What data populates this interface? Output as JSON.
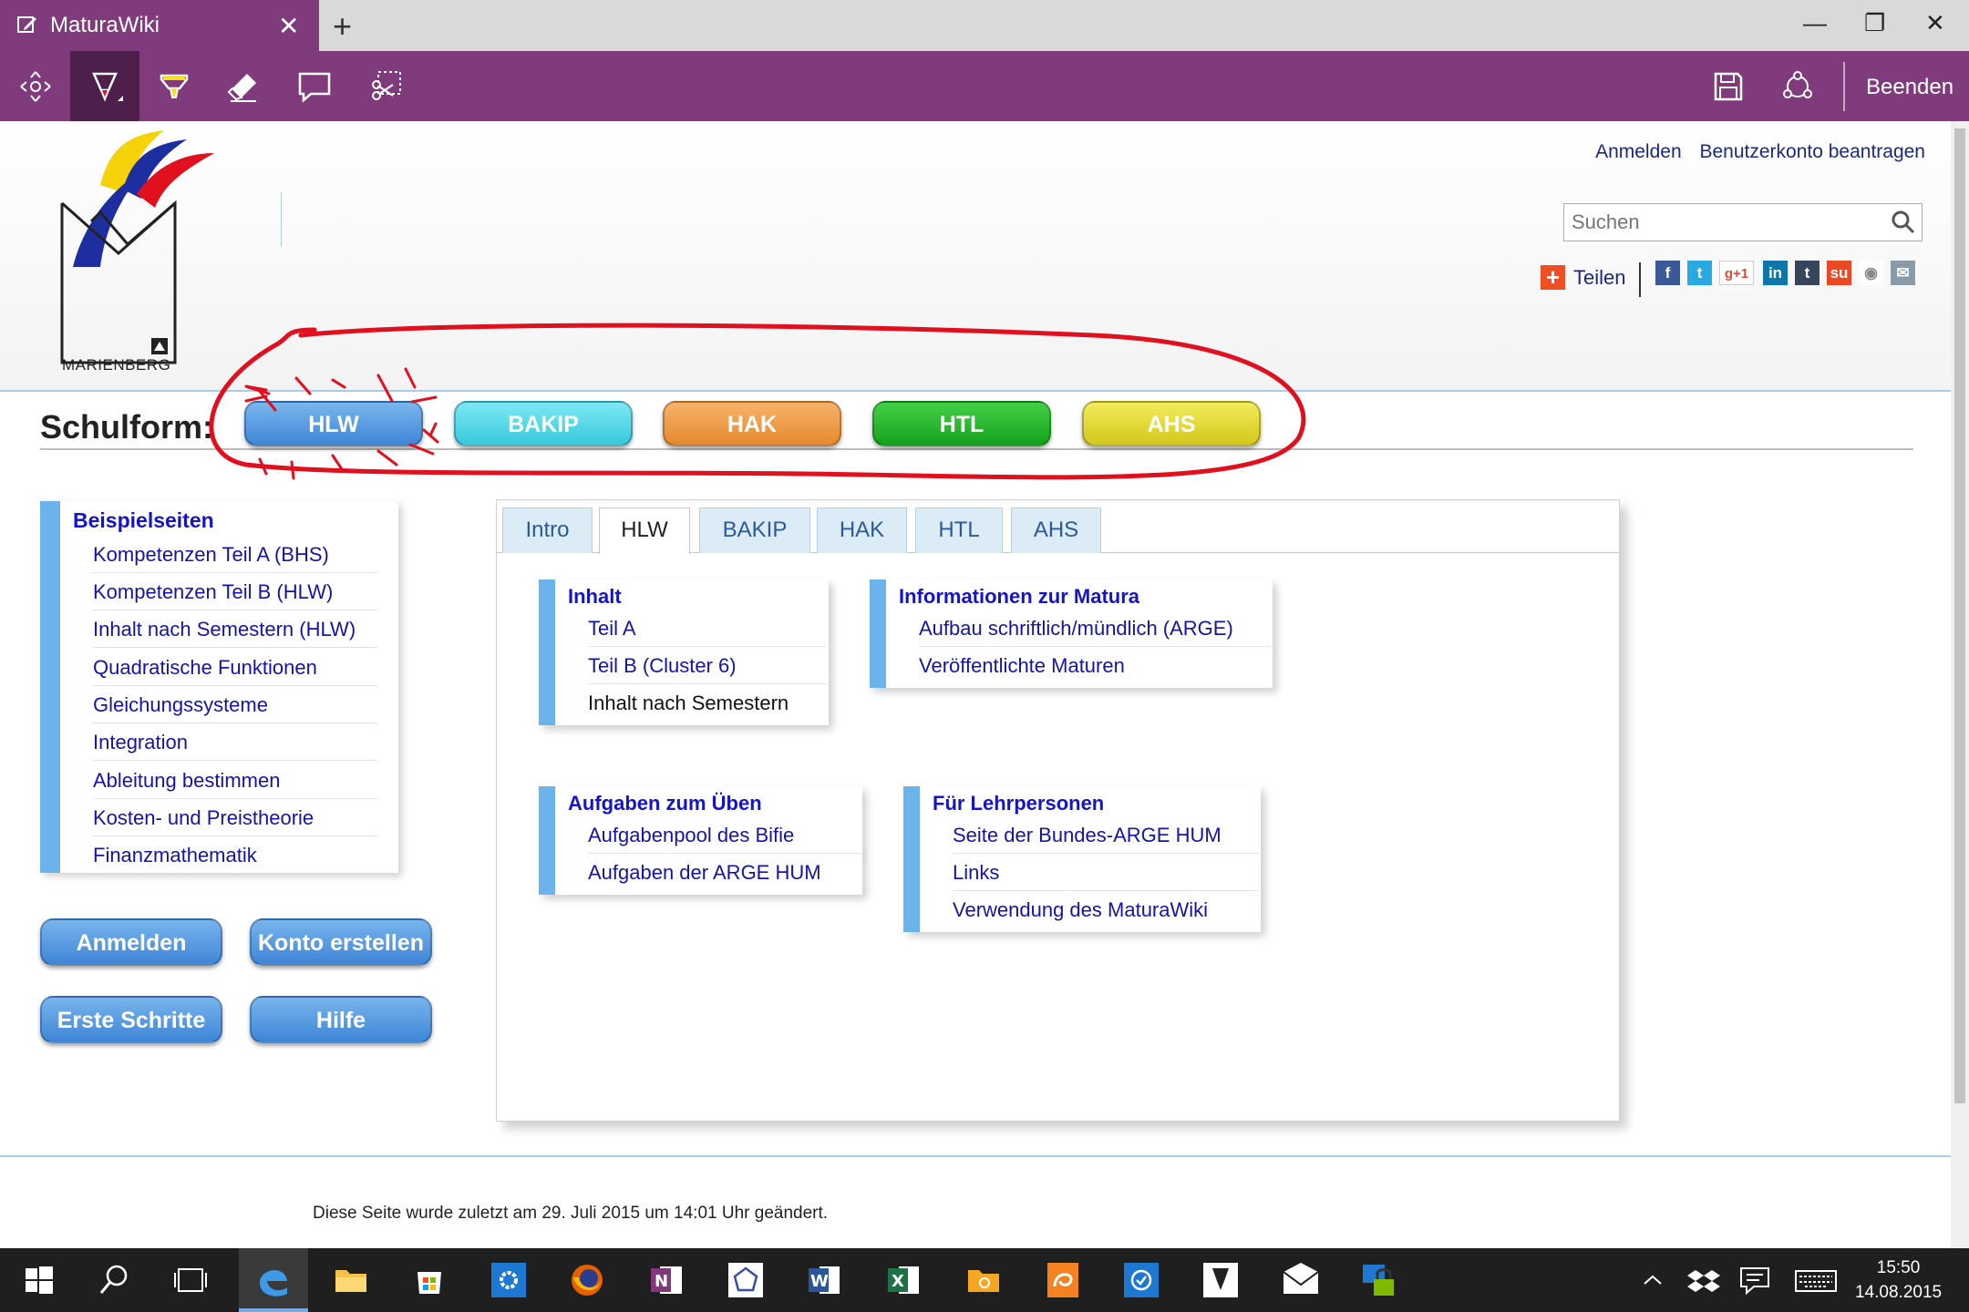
{
  "window": {
    "tab_title": "MaturaWiki",
    "close_tab": "✕",
    "new_tab": "+",
    "minimize": "—",
    "restore": "❐",
    "close": "✕"
  },
  "toolbar": {
    "tools": [
      "pan-icon",
      "pen-icon",
      "highlighter-icon",
      "eraser-icon",
      "comment-icon",
      "clip-icon"
    ],
    "exit_label": "Beenden"
  },
  "header": {
    "logo_text": "MARIENBERG",
    "login_link": "Anmelden",
    "register_link": "Benutzerkonto beantragen",
    "search_placeholder": "Suchen",
    "share_plus": "+",
    "share_label": "Teilen",
    "social": [
      {
        "name": "facebook",
        "glyph": "f",
        "color": "#3b5998"
      },
      {
        "name": "twitter",
        "glyph": "t",
        "color": "#29a9e1"
      },
      {
        "name": "googleplus",
        "glyph": "g+1",
        "color": "#ffffff"
      },
      {
        "name": "linkedin",
        "glyph": "in",
        "color": "#0e76a8"
      },
      {
        "name": "tumblr",
        "glyph": "t",
        "color": "#35465c"
      },
      {
        "name": "stumbleupon",
        "glyph": "su",
        "color": "#eb4924"
      },
      {
        "name": "reddit",
        "glyph": "◉",
        "color": "#ffffff"
      },
      {
        "name": "email",
        "glyph": "✉",
        "color": "#8a9aa8"
      }
    ]
  },
  "schulform": {
    "label": "Schulform:",
    "buttons": [
      {
        "label": "HLW",
        "color_top": "#7ab6ee",
        "color_bottom": "#3f86d8"
      },
      {
        "label": "BAKIP",
        "color_top": "#7ee8f4",
        "color_bottom": "#36c9dc"
      },
      {
        "label": "HAK",
        "color_top": "#f7b26a",
        "color_bottom": "#e58a2d"
      },
      {
        "label": "HTL",
        "color_top": "#45d04a",
        "color_bottom": "#15a11c"
      },
      {
        "label": "AHS",
        "color_top": "#f2ec5c",
        "color_bottom": "#d3c81c"
      }
    ]
  },
  "sidebar": {
    "heading": "Beispielseiten",
    "items": [
      "Kompetenzen Teil A (BHS)",
      "Kompetenzen Teil B (HLW)",
      "Inhalt nach Semestern (HLW)",
      "Quadratische Funktionen",
      "Gleichungssysteme",
      "Integration",
      "Ableitung bestimmen",
      "Kosten- und Preistheorie",
      "Finanzmathematik"
    ]
  },
  "side_buttons": {
    "login": "Anmelden",
    "create_account": "Konto erstellen",
    "first_steps": "Erste Schritte",
    "help": "Hilfe"
  },
  "panel": {
    "tabs": [
      "Intro",
      "HLW",
      "BAKIP",
      "HAK",
      "HTL",
      "AHS"
    ],
    "active_tab": "HLW",
    "boxes": {
      "inhalt": {
        "heading": "Inhalt",
        "items": [
          "Teil A",
          "Teil B (Cluster 6)",
          "Inhalt nach Semestern"
        ]
      },
      "info": {
        "heading": "Informationen zur Matura",
        "items": [
          "Aufbau schriftlich/mündlich (ARGE)",
          "Veröffentlichte Maturen"
        ]
      },
      "aufgaben": {
        "heading": "Aufgaben zum Üben",
        "items": [
          "Aufgabenpool des Bifie",
          "Aufgaben der ARGE HUM"
        ]
      },
      "lehrer": {
        "heading": "Für Lehrpersonen",
        "items": [
          "Seite der Bundes-ARGE HUM",
          "Links",
          "Verwendung des MaturaWiki"
        ]
      }
    }
  },
  "footer": {
    "last_modified": "Diese Seite wurde zuletzt am 29. Juli 2015 um 14:01 Uhr geändert."
  },
  "taskbar": {
    "time": "15:50",
    "date": "14.08.2015"
  },
  "colors": {
    "accent": "#7f3b7b",
    "link": "#1414a8",
    "sidebar_bar": "#6bb3ea",
    "annotation": "#e0101e"
  }
}
